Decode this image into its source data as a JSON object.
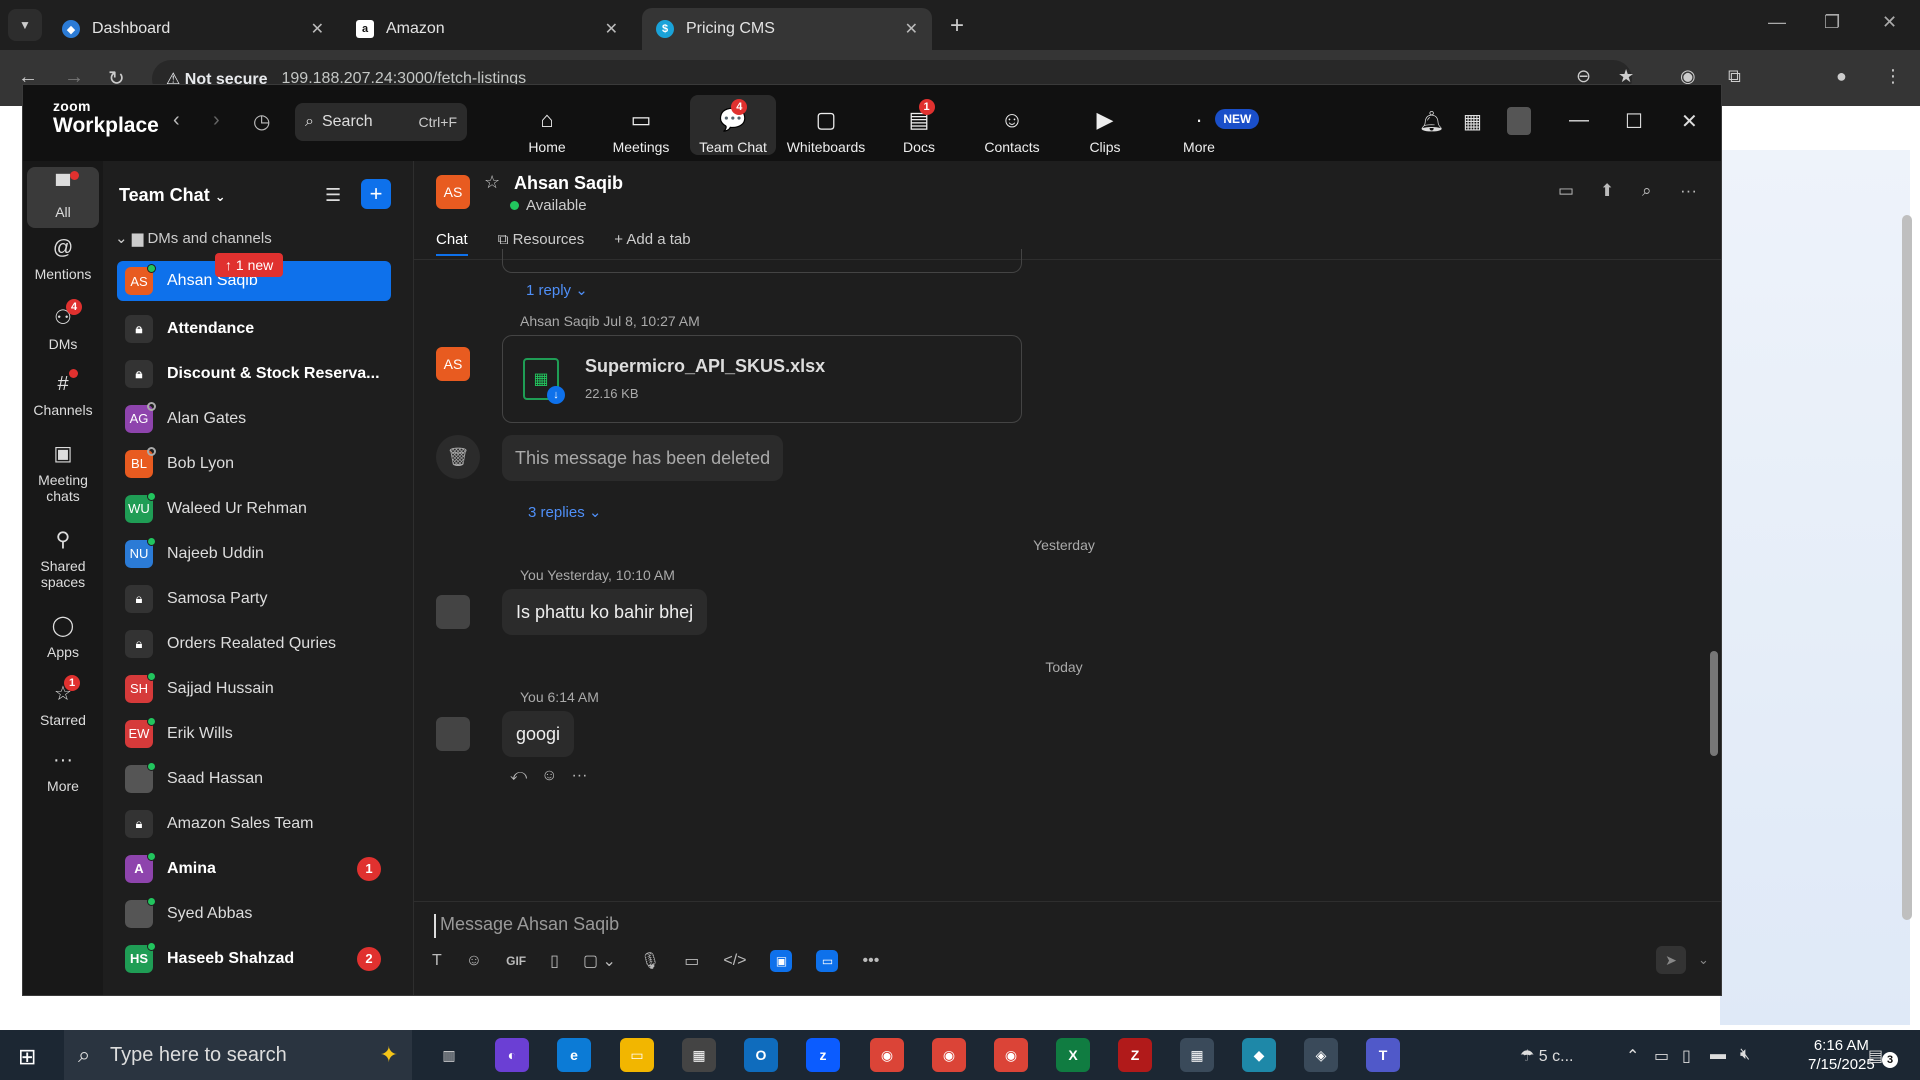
{
  "browser": {
    "tabs": [
      {
        "title": "Dashboard",
        "active": false
      },
      {
        "title": "Amazon",
        "active": false
      },
      {
        "title": "Pricing CMS",
        "active": true
      }
    ],
    "not_secure": "Not secure",
    "url": "199.188.207.24:3000/fetch-listings"
  },
  "zoom": {
    "logo_top": "zoom",
    "logo_bottom": "Workplace",
    "search_label": "Search",
    "search_shortcut": "Ctrl+F",
    "nav": [
      {
        "label": "Home",
        "icon": "home-icon"
      },
      {
        "label": "Meetings",
        "icon": "video-icon"
      },
      {
        "label": "Team Chat",
        "icon": "chat-icon",
        "badge": "4"
      },
      {
        "label": "Whiteboards",
        "icon": "whiteboard-icon"
      },
      {
        "label": "Docs",
        "icon": "docs-icon",
        "badge": "1"
      },
      {
        "label": "Contacts",
        "icon": "contacts-icon"
      },
      {
        "label": "Clips",
        "icon": "clips-icon"
      },
      {
        "label": "More",
        "icon": "more-icon",
        "tag": "NEW"
      }
    ],
    "rail": [
      {
        "label": "All"
      },
      {
        "label": "Mentions"
      },
      {
        "label": "DMs",
        "badge": "4"
      },
      {
        "label": "Channels"
      },
      {
        "label": "Meeting chats"
      },
      {
        "label": "Shared spaces"
      },
      {
        "label": "Apps"
      },
      {
        "label": "Starred",
        "badge": "1"
      },
      {
        "label": "More"
      }
    ],
    "sidebar": {
      "title": "Team Chat",
      "section": "DMs and channels",
      "new_pill": "1 new",
      "items": [
        {
          "name": "Ahsan Saqib",
          "initials": "AS",
          "color": "#e85b20"
        },
        {
          "name": "Attendance"
        },
        {
          "name": "Discount & Stock Reserva..."
        },
        {
          "name": "Alan Gates",
          "initials": "AG",
          "color": "#8e44ad"
        },
        {
          "name": "Bob Lyon",
          "initials": "BL",
          "color": "#e85b20"
        },
        {
          "name": "Waleed Ur Rehman",
          "initials": "WU",
          "color": "#1f9d55"
        },
        {
          "name": "Najeeb Uddin",
          "initials": "NU",
          "color": "#2b7bd6"
        },
        {
          "name": "Samosa Party"
        },
        {
          "name": "Orders Realated Quries"
        },
        {
          "name": "Sajjad Hussain",
          "initials": "SH",
          "color": "#d63a3a"
        },
        {
          "name": "Erik Wills",
          "initials": "EW",
          "color": "#d63a3a"
        },
        {
          "name": "Saad Hassan"
        },
        {
          "name": "Amazon Sales Team"
        },
        {
          "name": "Amina",
          "initials": "A",
          "color": "#8e44ad",
          "count": "1"
        },
        {
          "name": "Syed Abbas"
        },
        {
          "name": "Haseeb Shahzad",
          "initials": "HS",
          "color": "#1f9d55",
          "count": "2"
        }
      ]
    },
    "chat": {
      "initials": "AS",
      "name": "Ahsan Saqib",
      "status": "Available",
      "tabs": [
        "Chat",
        "Resources",
        "+ Add a tab"
      ],
      "reply1": "1 reply",
      "file_sender": "Ahsan Saqib",
      "file_time": "Jul 8, 10:27 AM",
      "file_name": "Supermicro_API_SKUS.xlsx",
      "file_size": "22.16 KB",
      "deleted_text": "This message has been deleted",
      "replies3": "3 replies",
      "day_yesterday": "Yesterday",
      "msg1_sender": "You",
      "msg1_time": "Yesterday, 10:10 AM",
      "msg1_text": "Is phattu ko bahir bhej",
      "day_today": "Today",
      "msg2_sender": "You",
      "msg2_time": "6:14 AM",
      "msg2_text": "googi",
      "composer_placeholder": "Message Ahsan Saqib"
    }
  },
  "taskbar": {
    "search_placeholder": "Type here to search",
    "weather": "5 c...",
    "time": "6:16 AM",
    "date": "7/15/2025",
    "notif_count": "3"
  }
}
